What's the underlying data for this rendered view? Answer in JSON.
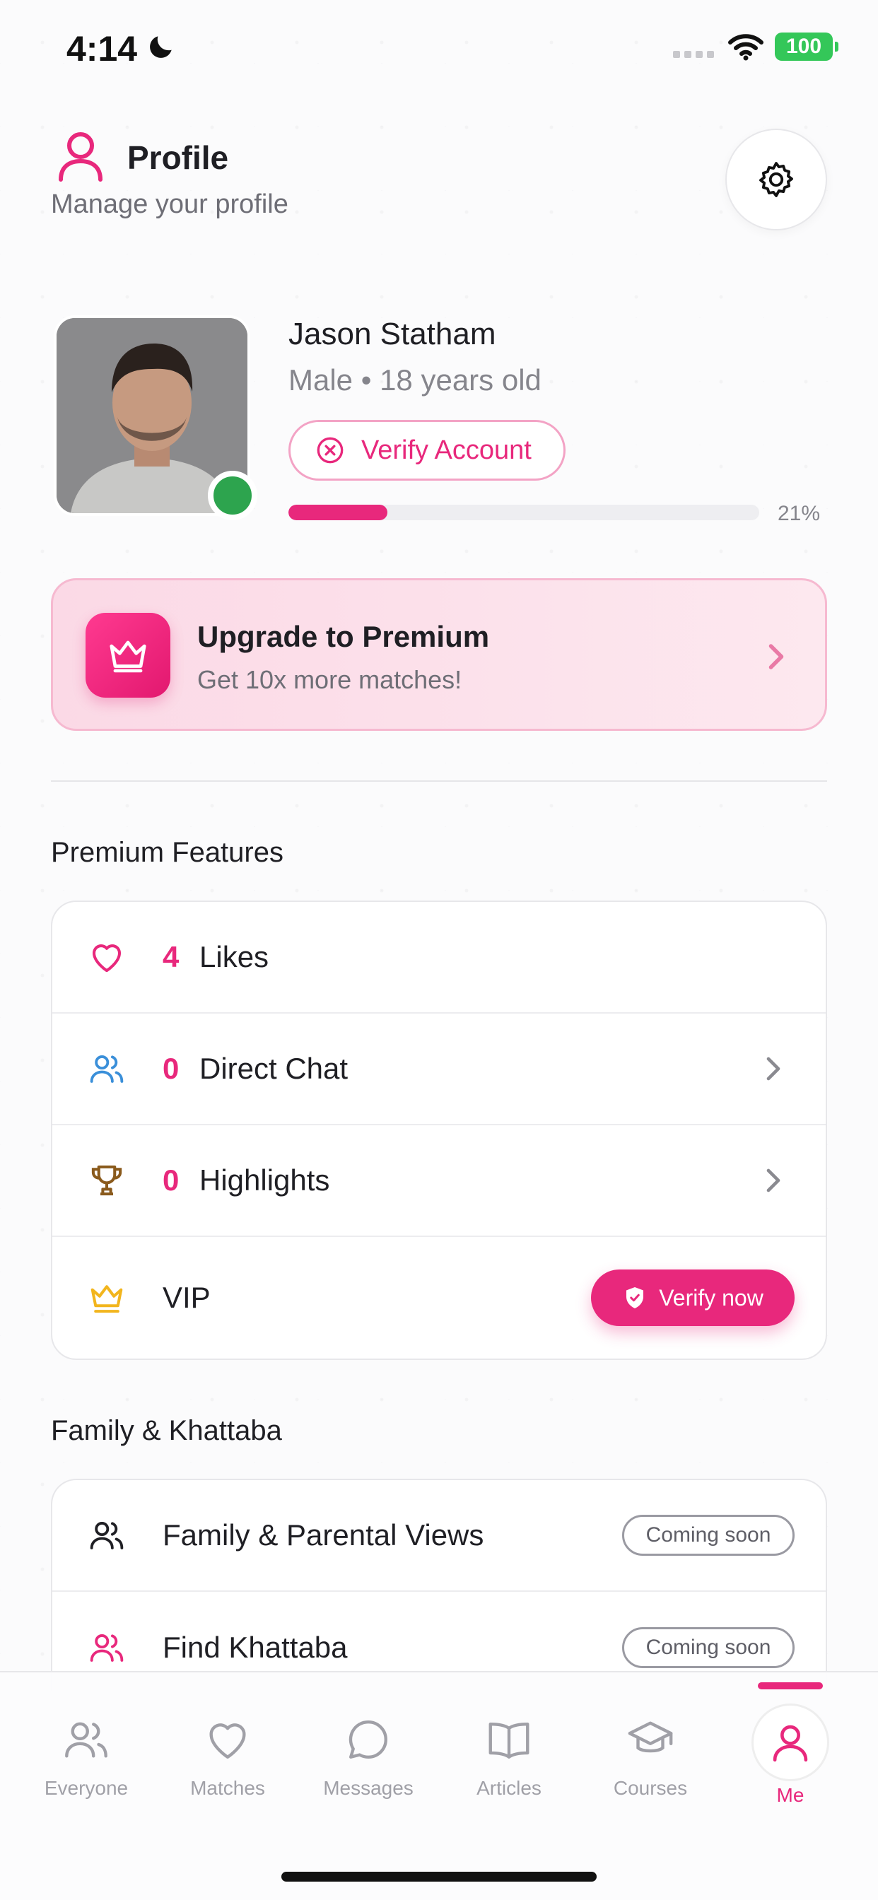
{
  "status_bar": {
    "time": "4:14",
    "battery": "100"
  },
  "header": {
    "title": "Profile",
    "subtitle": "Manage your profile"
  },
  "profile": {
    "name": "Jason Statham",
    "meta": "Male • 18 years old",
    "verify_label": "Verify Account",
    "progress_percent": 21,
    "progress_label": "21%"
  },
  "premium": {
    "title": "Upgrade to Premium",
    "subtitle": "Get 10x more matches!"
  },
  "premium_features": {
    "title": "Premium Features",
    "items": [
      {
        "count": "4",
        "label": "Likes",
        "icon": "heart-icon"
      },
      {
        "count": "0",
        "label": "Direct Chat",
        "icon": "users-icon"
      },
      {
        "count": "0",
        "label": "Highlights",
        "icon": "trophy-icon"
      },
      {
        "label": "VIP",
        "icon": "crown-icon",
        "action": "Verify now"
      }
    ]
  },
  "family": {
    "title": "Family & Khattaba",
    "items": [
      {
        "label": "Family & Parental Views",
        "badge": "Coming soon",
        "icon": "users-icon"
      },
      {
        "label": "Find Khattaba",
        "badge": "Coming soon",
        "icon": "users-icon"
      }
    ]
  },
  "tabs": [
    {
      "label": "Everyone"
    },
    {
      "label": "Matches"
    },
    {
      "label": "Messages"
    },
    {
      "label": "Articles"
    },
    {
      "label": "Courses"
    },
    {
      "label": "Me"
    }
  ],
  "colors": {
    "accent": "#e8287c",
    "online": "#2da44e",
    "premium_bg": "#fbd9e6"
  }
}
